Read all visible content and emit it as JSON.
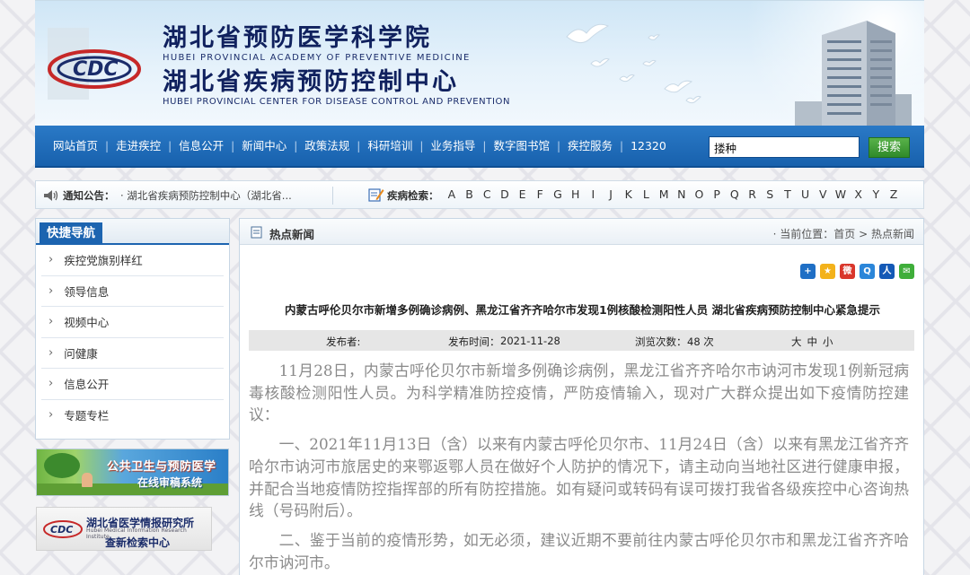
{
  "header": {
    "title_cn_1": "湖北省预防医学科学院",
    "title_en_1": "HUBEI PROVINCIAL ACADEMY OF PREVENTIVE MEDICINE",
    "title_cn_2": "湖北省疾病预防控制中心",
    "title_en_2": "HUBEI PROVINCIAL CENTER FOR DISEASE CONTROL AND PREVENTION",
    "logo_text": "CDC"
  },
  "nav": {
    "items": [
      "网站首页",
      "走进疾控",
      "信息公开",
      "新闻中心",
      "政策法规",
      "科研培训",
      "业务指导",
      "数字图书馆",
      "疾控服务",
      "12320"
    ],
    "search_value": "搂种",
    "search_button": "搜索"
  },
  "notice": {
    "label": "通知公告：",
    "text": "· 湖北省疾病预防控制中心（湖北省...",
    "index_label": "疾病检索：",
    "letters": [
      "A",
      "B",
      "C",
      "D",
      "E",
      "F",
      "G",
      "H",
      "I",
      "J",
      "K",
      "L",
      "M",
      "N",
      "O",
      "P",
      "Q",
      "R",
      "S",
      "T",
      "U",
      "V",
      "W",
      "X",
      "Y",
      "Z"
    ]
  },
  "sidebar": {
    "heading": "快捷导航",
    "items": [
      "疾控党旗别样红",
      "领导信息",
      "视频中心",
      "问健康",
      "信息公开",
      "专题专栏"
    ],
    "promo_line1": "公共卫生与预防医学",
    "promo_line2": "在线审稿系统",
    "card_title": "湖北省医学情报研究所",
    "card_subtitle": "Hubei Medical Information Research Institute",
    "card_action": "查新检索中心"
  },
  "main": {
    "section_title": "热点新闻",
    "breadcrumb_prefix": "· 当前位置：",
    "breadcrumb_home": "首页",
    "breadcrumb_sep": " > ",
    "breadcrumb_current": "热点新闻",
    "article_title": "内蒙古呼伦贝尔市新增多例确诊病例、黑龙江省齐齐哈尔市发现1例核酸检测阳性人员 湖北省疾病预防控制中心紧急提示",
    "meta": {
      "publisher_label": "发布者:",
      "publisher": "",
      "time_label": "发布时间：",
      "time": "2021-11-28",
      "views_label": "浏览次数：",
      "views": "48 次",
      "size_large": "大",
      "size_medium": "中",
      "size_small": "小"
    },
    "paragraphs": [
      "11月28日，内蒙古呼伦贝尔市新增多例确诊病例，黑龙江省齐齐哈尔市讷河市发现1例新冠病毒核酸检测阳性人员。为科学精准防控疫情，严防疫情输入，现对广大群众提出如下疫情防控建议：",
      "一、2021年11月13日（含）以来有内蒙古呼伦贝尔市、11月24日（含）以来有黑龙江省齐齐哈尔市讷河市旅居史的来鄂返鄂人员在做好个人防护的情况下，请主动向当地社区进行健康申报，并配合当地疫情防控指挥部的所有防控措施。如有疑问或转码有误可拨打我省各级疾控中心咨询热线（号码附后）。",
      "二、鉴于当前的疫情形势，如无必须，建议近期不要前往内蒙古呼伦贝尔市和黑龙江省齐齐哈尔市讷河市。"
    ]
  },
  "colors": {
    "nav_blue": "#1c64b0",
    "title_navy": "#10215e",
    "search_green": "#2f8a29",
    "body_gray": "#8a8a8a"
  }
}
